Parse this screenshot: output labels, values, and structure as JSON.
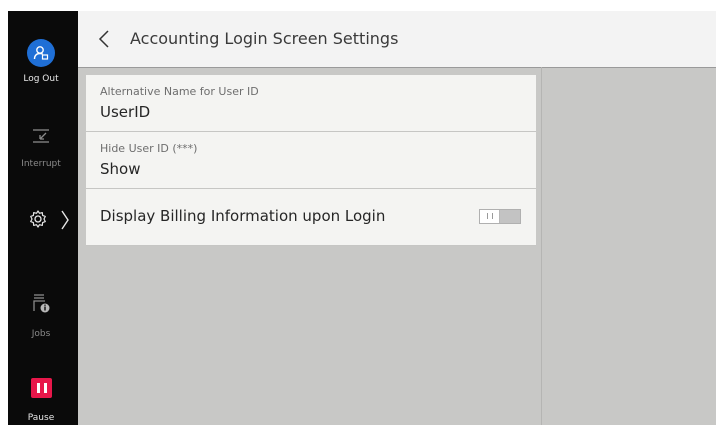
{
  "sidebar": {
    "logout_label": "Log Out",
    "interrupt_label": "Interrupt",
    "jobs_label": "Jobs",
    "pause_label": "Pause",
    "icons": {
      "logout": "user-logout-icon",
      "interrupt": "interrupt-icon",
      "settings": "gear-icon",
      "jobs": "jobs-icon",
      "pause": "pause-icon"
    }
  },
  "header": {
    "title": "Accounting Login Screen Settings",
    "back_icon": "chevron-left-icon"
  },
  "settings": {
    "items": [
      {
        "label": "Alternative Name for User ID",
        "value": "UserID"
      },
      {
        "label": "Hide User ID (***)",
        "value": "Show"
      },
      {
        "label": "Display Billing Information upon Login",
        "toggle": "off"
      }
    ]
  },
  "colors": {
    "sidebar_bg": "#0a0a0a",
    "logout_accent": "#1f6fd6",
    "pause_accent": "#e8174a",
    "content_bg": "#c8c8c6",
    "row_bg": "#f4f4f2"
  }
}
